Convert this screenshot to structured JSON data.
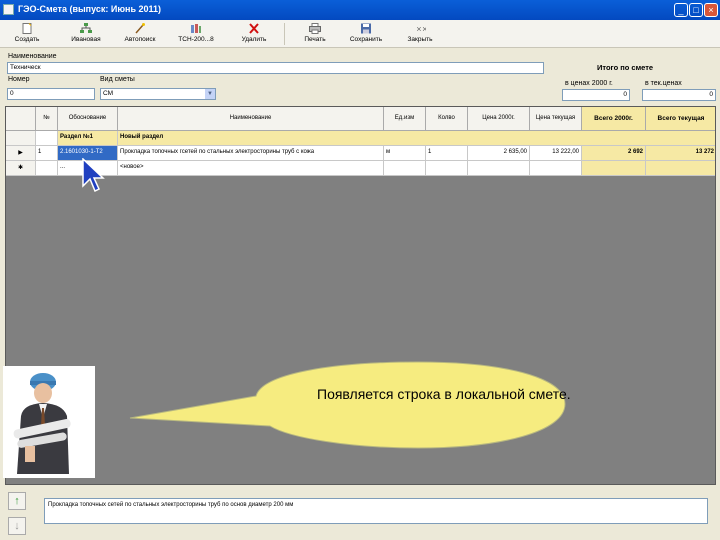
{
  "window": {
    "title": "ГЭО-Смета (выпуск: Июнь 2011)"
  },
  "toolbar": {
    "create": "Создать",
    "prices": "Ивановая",
    "autosearch": "Автопоиск",
    "tsn": "ТСН-200...8",
    "delete": "Удалить",
    "print": "Печать",
    "save": "Сохранить",
    "close": "Закрыть"
  },
  "form": {
    "name_label": "Наименование",
    "name_value": "Техническ",
    "total_label": "Итого по смете",
    "number_label": "Номер",
    "number_value": "0",
    "type_label": "Вид сметы",
    "type_value": "СМ",
    "price2000_label": "в ценах 2000 г.",
    "price2000_value": "0",
    "current_label": "в тек.ценах",
    "current_value": "0"
  },
  "table": {
    "headers": [
      "№",
      "Обоснование",
      "Наименование",
      "Ед.изм",
      "Колво",
      "Цена 2000г.",
      "Цена текущая",
      "Всего 2000г.",
      "Всего текущая"
    ],
    "section": {
      "code": "Раздел №1",
      "name": "Новый раздел"
    },
    "row": {
      "marker": "▶",
      "num": "1",
      "code": "2.1601030-1-Т2",
      "name": "Прокладка топочных гсетей по стальных электросторины труб с кожа",
      "unit": "м",
      "qty": "1",
      "price2000": "2 635,00",
      "pricecur": "13 222,00",
      "total2000": "2 692",
      "totalcur": "13 272"
    },
    "newrow": {
      "marker": "✱",
      "code": "...",
      "name": "<новое>"
    }
  },
  "callout": {
    "text": "Появляется строка в локальной смете."
  },
  "memo": {
    "text": "Прокладка топочных сетей по стальных электросторины труб по основ диаметр 200 мм"
  },
  "nav": {
    "up": "↑",
    "down": "↓"
  }
}
